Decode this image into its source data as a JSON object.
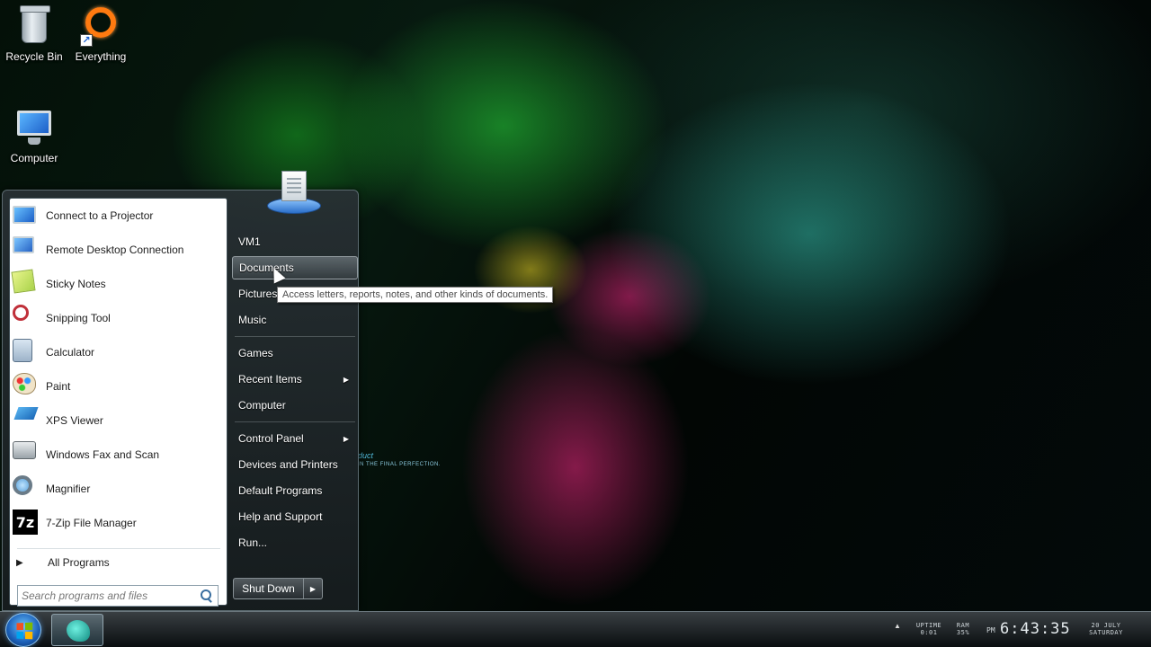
{
  "desktop": {
    "icons": [
      {
        "label": "Recycle Bin",
        "icon": "recycle-bin-icon"
      },
      {
        "label": "Everything",
        "icon": "everything-icon"
      },
      {
        "label": "Computer",
        "icon": "computer-icon"
      }
    ],
    "wallpaper_text": "duct",
    "wallpaper_subtext": "IN THE FINAL PERFECTION."
  },
  "start_menu": {
    "programs": [
      {
        "label": "Connect to a Projector",
        "icon": "projector-icon"
      },
      {
        "label": "Remote Desktop Connection",
        "icon": "remote-desktop-icon"
      },
      {
        "label": "Sticky Notes",
        "icon": "sticky-notes-icon"
      },
      {
        "label": "Snipping Tool",
        "icon": "scissors-icon"
      },
      {
        "label": "Calculator",
        "icon": "calculator-icon"
      },
      {
        "label": "Paint",
        "icon": "paint-palette-icon"
      },
      {
        "label": "XPS Viewer",
        "icon": "xps-viewer-icon"
      },
      {
        "label": "Windows Fax and Scan",
        "icon": "fax-icon"
      },
      {
        "label": "Magnifier",
        "icon": "magnifier-icon"
      },
      {
        "label": "7-Zip File Manager",
        "icon": "7zip-icon",
        "glyph": "7z"
      }
    ],
    "all_programs": "All Programs",
    "search": {
      "placeholder": "Search programs and files",
      "value": ""
    },
    "right_items": [
      {
        "label": "VM1"
      },
      {
        "label": "Documents",
        "hover": true
      },
      {
        "label": "Pictures"
      },
      {
        "label": "Music"
      },
      {
        "label": "Games"
      },
      {
        "label": "Recent Items",
        "submenu": true
      },
      {
        "label": "Computer"
      },
      {
        "label": "Control Panel",
        "submenu": true
      },
      {
        "label": "Devices and Printers"
      },
      {
        "label": "Default Programs"
      },
      {
        "label": "Help and Support"
      },
      {
        "label": "Run..."
      }
    ],
    "shutdown": "Shut Down",
    "tooltip": "Access letters, reports, notes, and other kinds of documents."
  },
  "taskbar": {
    "uptime_label": "UPTIME",
    "uptime_value": "0:01",
    "ram_label": "RAM",
    "ram_value": "35%",
    "ampm": "PM",
    "time": "6:43:35",
    "date": "20 JULY",
    "day": "SATURDAY"
  },
  "colors": {
    "accent": "#1b5fb8",
    "everything_orange": "#ff7a10"
  }
}
